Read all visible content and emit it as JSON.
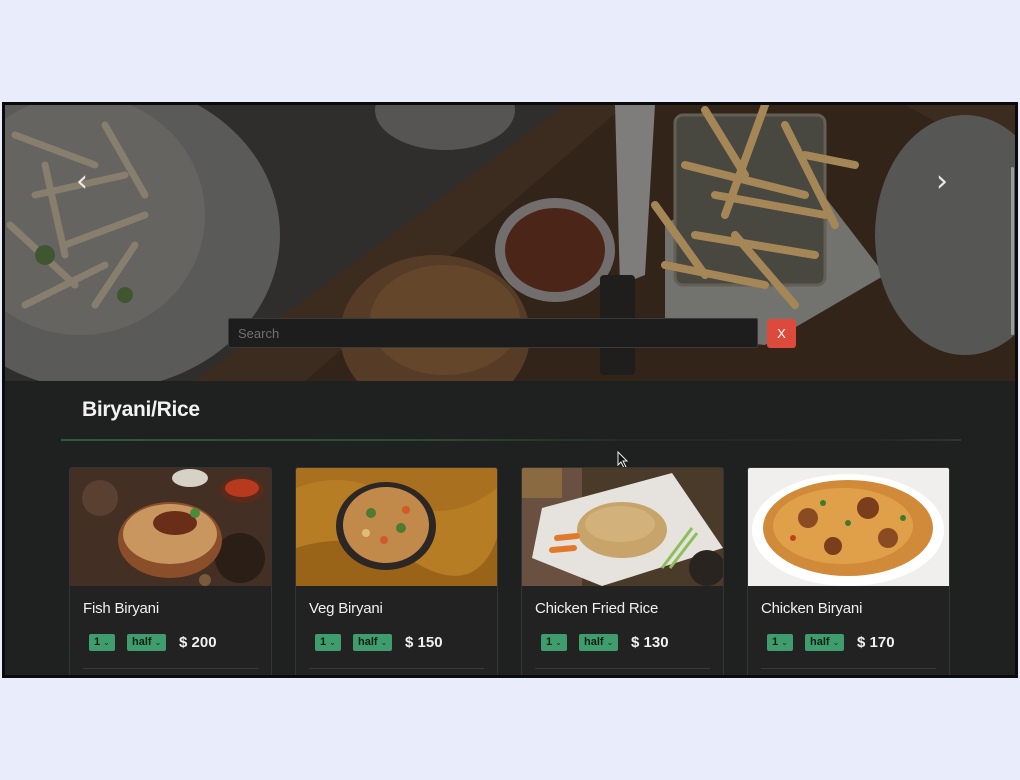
{
  "hero": {
    "prev_icon": "chevron-left-icon",
    "next_icon": "chevron-right-icon",
    "search": {
      "placeholder": "Search",
      "value": ""
    },
    "clear_label": "X"
  },
  "section": {
    "title": "Biryani/Rice"
  },
  "colors": {
    "accent": "#3f9d6d",
    "danger": "#dc4a3c",
    "background": "#1f2020"
  },
  "menu": {
    "items": [
      {
        "name": "Fish Biryani",
        "quantity": "1",
        "size": "half",
        "price": "$ 200"
      },
      {
        "name": "Veg Biryani",
        "quantity": "1",
        "size": "half",
        "price": "$ 150"
      },
      {
        "name": "Chicken Fried Rice",
        "quantity": "1",
        "size": "half",
        "price": "$ 130"
      },
      {
        "name": "Chicken Biryani",
        "quantity": "1",
        "size": "half",
        "price": "$ 170"
      }
    ]
  }
}
